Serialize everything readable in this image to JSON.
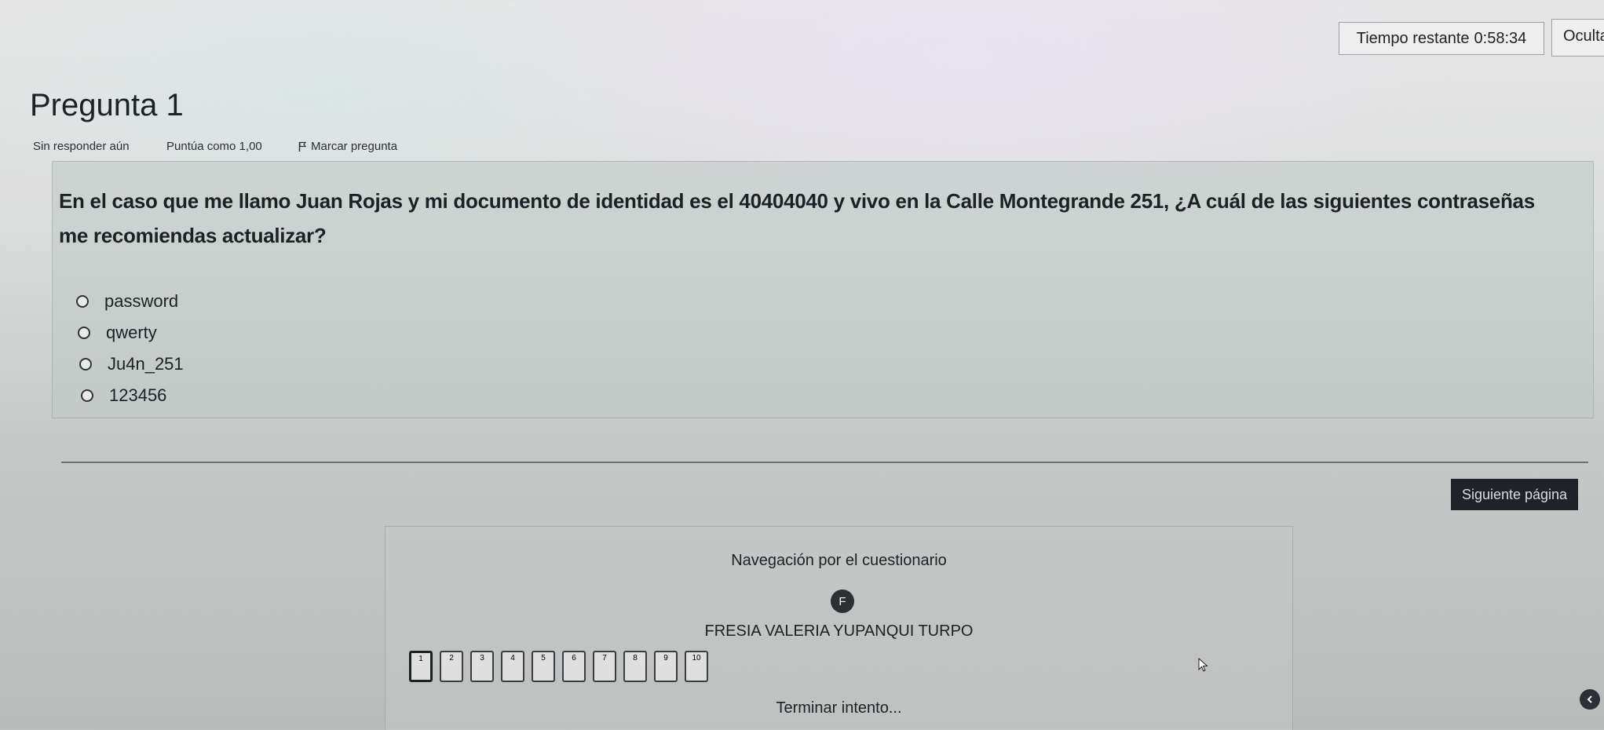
{
  "timer": {
    "label": "Tiempo restante",
    "time": "0:58:34",
    "hide_label": "Oculta"
  },
  "question": {
    "title": "Pregunta 1",
    "state": "Sin responder aún",
    "grade": "Puntúa como 1,00",
    "flag_label": "Marcar pregunta",
    "text_line1": "En el caso que me llamo Juan Rojas y mi documento de identidad es el 40404040 y vivo en la Calle Montegrande 251, ¿A cuál de las siguientes contraseñas",
    "text_line2": "me recomiendas actualizar?",
    "answers": [
      {
        "label": "password"
      },
      {
        "label": "qwerty"
      },
      {
        "label": "Ju4n_251"
      },
      {
        "label": "123456"
      }
    ]
  },
  "next_label": "Siguiente página",
  "navigation": {
    "title": "Navegación por el cuestionario",
    "avatar_initial": "F",
    "user_name": "FRESIA VALERIA YUPANQUI TURPO",
    "questions": [
      "1",
      "2",
      "3",
      "4",
      "5",
      "6",
      "7",
      "8",
      "9",
      "10"
    ],
    "current": "1",
    "finish_label": "Terminar intento..."
  },
  "icons": {
    "flag": "flag-icon",
    "radio": "radio-icon",
    "cursor": "mouse-cursor-icon",
    "scroll": "chevron-left-icon"
  }
}
